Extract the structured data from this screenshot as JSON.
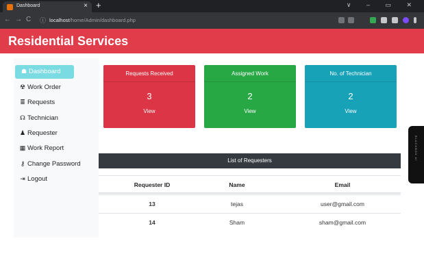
{
  "browser": {
    "tab_title": "Dashboard",
    "tab_close": "×",
    "new_tab": "+",
    "window_controls": "∨ – ▭ ✕",
    "nav_back": "←",
    "nav_forward": "→",
    "nav_reload": "C",
    "url_info_icon": "ⓘ",
    "url_host": "localhost",
    "url_path": "/home/Admin/dashboard.php"
  },
  "header": {
    "brand": "Residential Services"
  },
  "sidebar": {
    "items": [
      {
        "icon": "☗",
        "label": "Dashboard"
      },
      {
        "icon": "☢",
        "label": "Work Order"
      },
      {
        "icon": "≣",
        "label": "Requests"
      },
      {
        "icon": "☊",
        "label": "Technician"
      },
      {
        "icon": "♟",
        "label": "Requester"
      },
      {
        "icon": "▦",
        "label": "Work Report"
      },
      {
        "icon": "⚷",
        "label": "Change Password"
      },
      {
        "icon": "⇥",
        "label": "Logout"
      }
    ]
  },
  "cards": [
    {
      "title": "Requests Received",
      "count": "3",
      "link": "View",
      "color": "#dc3545"
    },
    {
      "title": "Assigned Work",
      "count": "2",
      "link": "View",
      "color": "#28a745"
    },
    {
      "title": "No. of Technician",
      "count": "2",
      "link": "View",
      "color": "#17a2b8"
    }
  ],
  "requesters": {
    "title": "List of Requesters",
    "columns": [
      "Requester ID",
      "Name",
      "Email"
    ],
    "rows": [
      [
        "13",
        "tejas",
        "user@gmail.com"
      ],
      [
        "14",
        "Sham",
        "sham@gmail.com"
      ]
    ]
  },
  "widget": {
    "label": "BLACKBOX AI"
  }
}
